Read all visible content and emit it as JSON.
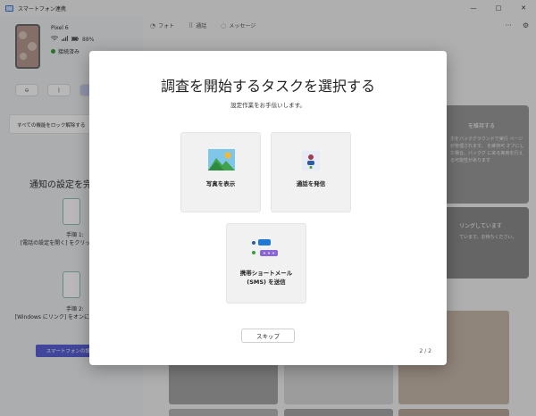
{
  "window": {
    "title": "スマートフォン連携",
    "controls": {
      "minimize": "—",
      "maximize": "□",
      "close": "✕"
    }
  },
  "device": {
    "name": "Pixel 6",
    "battery": "88%",
    "status": "接続済み"
  },
  "left_panel": {
    "lock_setting": "すべての機能をロック解除する",
    "notif_title": "通知の設定を完",
    "step1_label": "手順 1:",
    "step1_text": "[電話の設定を開く] をクリッ のロックを解除し",
    "step2_label": "手順 2:",
    "step2_text": "[Windows にリンク] をオンに 可] をクリックしま",
    "settings_button": "スマートフォンの設定"
  },
  "nav": {
    "tabs": [
      {
        "label": "フォト",
        "icon": "photo-icon"
      },
      {
        "label": "通話",
        "icon": "dialpad-icon"
      },
      {
        "label": "メッセージ",
        "icon": "message-icon"
      }
    ],
    "more": "···",
    "settings": "⚙"
  },
  "bg_cards": {
    "card1_title": "を維持する",
    "card1_text": "ホをバックグラウンドで実行 ページが管理されます。 を維持可 オフにした場合、バックグ に来る実用を行える可能性があります",
    "card2_title": "リングしています",
    "card2_text": "ています。お待ちください。"
  },
  "dialog": {
    "title": "調査を開始するタスクを選択する",
    "subtitle": "設定作業をお手伝いします。",
    "tasks": [
      {
        "label": "写真を表示",
        "icon": "landscape-photo-icon"
      },
      {
        "label": "通話を発信",
        "icon": "phone-call-icon"
      },
      {
        "label_line1": "携帯ショートメール",
        "label_line2": "(SMS) を送信",
        "icon": "sms-bubbles-icon"
      }
    ],
    "skip_button": "スキップ",
    "pager": "2 / 2"
  },
  "colors": {
    "accent": "#5b62d6",
    "green_status": "#3b9b3b"
  }
}
